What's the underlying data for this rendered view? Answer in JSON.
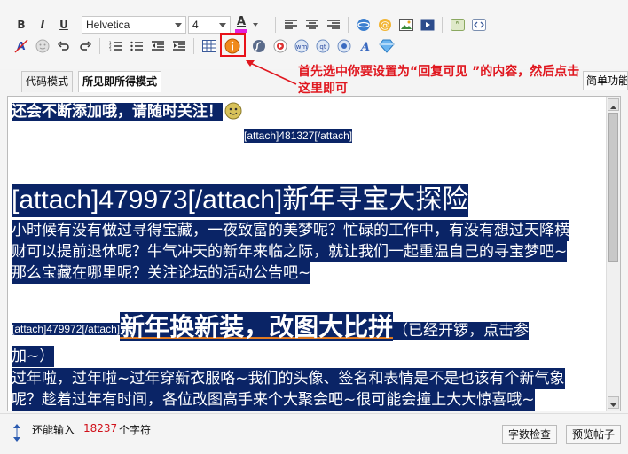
{
  "toolbar": {
    "bold": "B",
    "italic": "I",
    "underline": "U",
    "font_family": "Helvetica",
    "font_size": "4",
    "text_color": "A",
    "smiley_plus": "+"
  },
  "tabs": {
    "code_mode": "代码模式",
    "wysiwyg_mode": "所见即所得模式",
    "simple_function": "简单功能"
  },
  "annotation": {
    "text": "首先选中你要设置为“回复可见 ”的内容，然后点击这里即可",
    "color": "#e0171f"
  },
  "editor": {
    "line1": "还会不断添加哦，请随时关注！",
    "attach1": "[attach]481327[/attach]",
    "heading1": "[attach]479973[/attach]新年寻宝大探险",
    "para1_l1": "小时候有没有做过寻得宝藏，一夜致富的美梦呢？忙碌的工作中，有没有想过天降横",
    "para1_l2": "财可以提前退休呢？牛气冲天的新年来临之际，就让我们一起重温自己的寻宝梦吧~",
    "para1_l3": "那么宝藏在哪里呢？关注论坛的活动公告吧~",
    "attach2": "[attach]479972[/attach]",
    "heading2": "新年换新装，改图大比拼",
    "heading2_suffix": "（已经开锣，点击参",
    "heading2_cont": "加~）",
    "para2_l1": "过年啦，过年啦~过年穿新衣服咯~我们的头像、签名和表情是不是也该有个新气象",
    "para2_l2": "呢？趁着过年有时间，各位改图高手来个大聚会吧~很可能会撞上大大惊喜哦~",
    "selection_color": "#0a2466"
  },
  "footer": {
    "can_input": "还能输入",
    "char_count": "18237",
    "char_unit": "个字符",
    "word_count_button": "字数检查",
    "preview_button": "预览帖子"
  }
}
